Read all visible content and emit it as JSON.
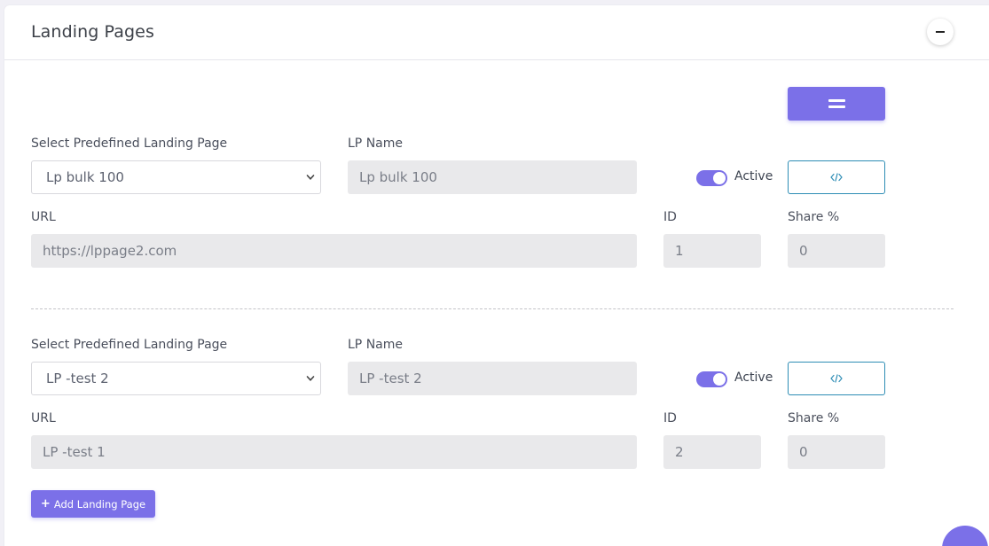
{
  "card": {
    "title": "Landing Pages"
  },
  "labels": {
    "select_lp": "Select Predefined Landing Page",
    "lp_name": "LP Name",
    "url": "URL",
    "id": "ID",
    "share": "Share %",
    "active": "Active"
  },
  "landing_pages": [
    {
      "selected_lp": "Lp bulk 100",
      "lp_name": "Lp bulk 100",
      "active": true,
      "url": "https://lppage2.com",
      "id": "1",
      "share": "0"
    },
    {
      "selected_lp": "LP -test 2",
      "lp_name": "LP -test 2",
      "active": true,
      "url": "LP -test 1",
      "id": "2",
      "share": "0"
    }
  ],
  "add_button": {
    "label": "Add Landing Page"
  },
  "icons": {
    "collapse": "minus-icon",
    "drag": "drag-handle-icon",
    "code": "code-icon",
    "add": "plus-icon",
    "select": "chevron-down-icon"
  },
  "colors": {
    "accent": "#7b70e8",
    "code_border": "#2e8db5",
    "input_bg": "#e9e9eb",
    "page_bg": "#f1f0f6"
  }
}
